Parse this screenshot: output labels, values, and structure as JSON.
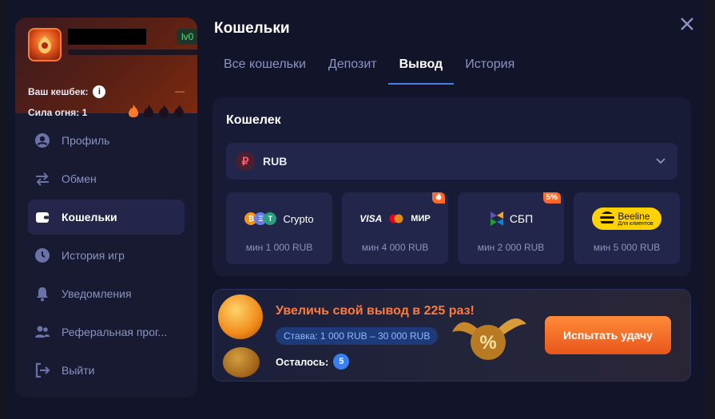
{
  "profile": {
    "level": "lv0",
    "cashback_label": "Ваш кешбек:",
    "cashback_value": "—",
    "fire_label": "Сила огня: 1"
  },
  "menu": {
    "items": [
      {
        "label": "Профиль",
        "icon": "user-icon"
      },
      {
        "label": "Обмен",
        "icon": "exchange-icon"
      },
      {
        "label": "Кошельки",
        "icon": "wallet-icon",
        "active": true
      },
      {
        "label": "История игр",
        "icon": "clock-icon"
      },
      {
        "label": "Уведомления",
        "icon": "bell-icon"
      },
      {
        "label": "Реферальная прог...",
        "icon": "users-icon"
      },
      {
        "label": "Выйти",
        "icon": "logout-icon"
      }
    ]
  },
  "main": {
    "title": "Кошельки",
    "tabs": [
      "Все кошельки",
      "Депозит",
      "Вывод",
      "История"
    ],
    "active_tab": "Вывод"
  },
  "wallet": {
    "title": "Кошелек",
    "currency": "RUB",
    "methods": [
      {
        "name": "Crypto",
        "min": "мин 1 000 RUB",
        "badge": ""
      },
      {
        "name": "VISA MIR",
        "visa": "VISA",
        "mir": "МИР",
        "min": "мин 4 000 RUB",
        "badge": "fire"
      },
      {
        "name": "СБП",
        "min": "мин 2 000 RUB",
        "badge": "5%"
      },
      {
        "name": "Beeline",
        "sub": "Для клиентов",
        "min": "мин 5 000 RUB",
        "badge": ""
      }
    ]
  },
  "promo": {
    "title": "Увеличь свой вывод в 225 раз!",
    "rate": "Ставка: 1 000 RUB – 30 000 RUB",
    "left_label": "Осталось:",
    "left_count": "5",
    "button": "Испытать удачу"
  },
  "colors": {
    "accent": "#ff6a2a",
    "tab_underline": "#4a7fe6",
    "level": "#4ee07a"
  }
}
